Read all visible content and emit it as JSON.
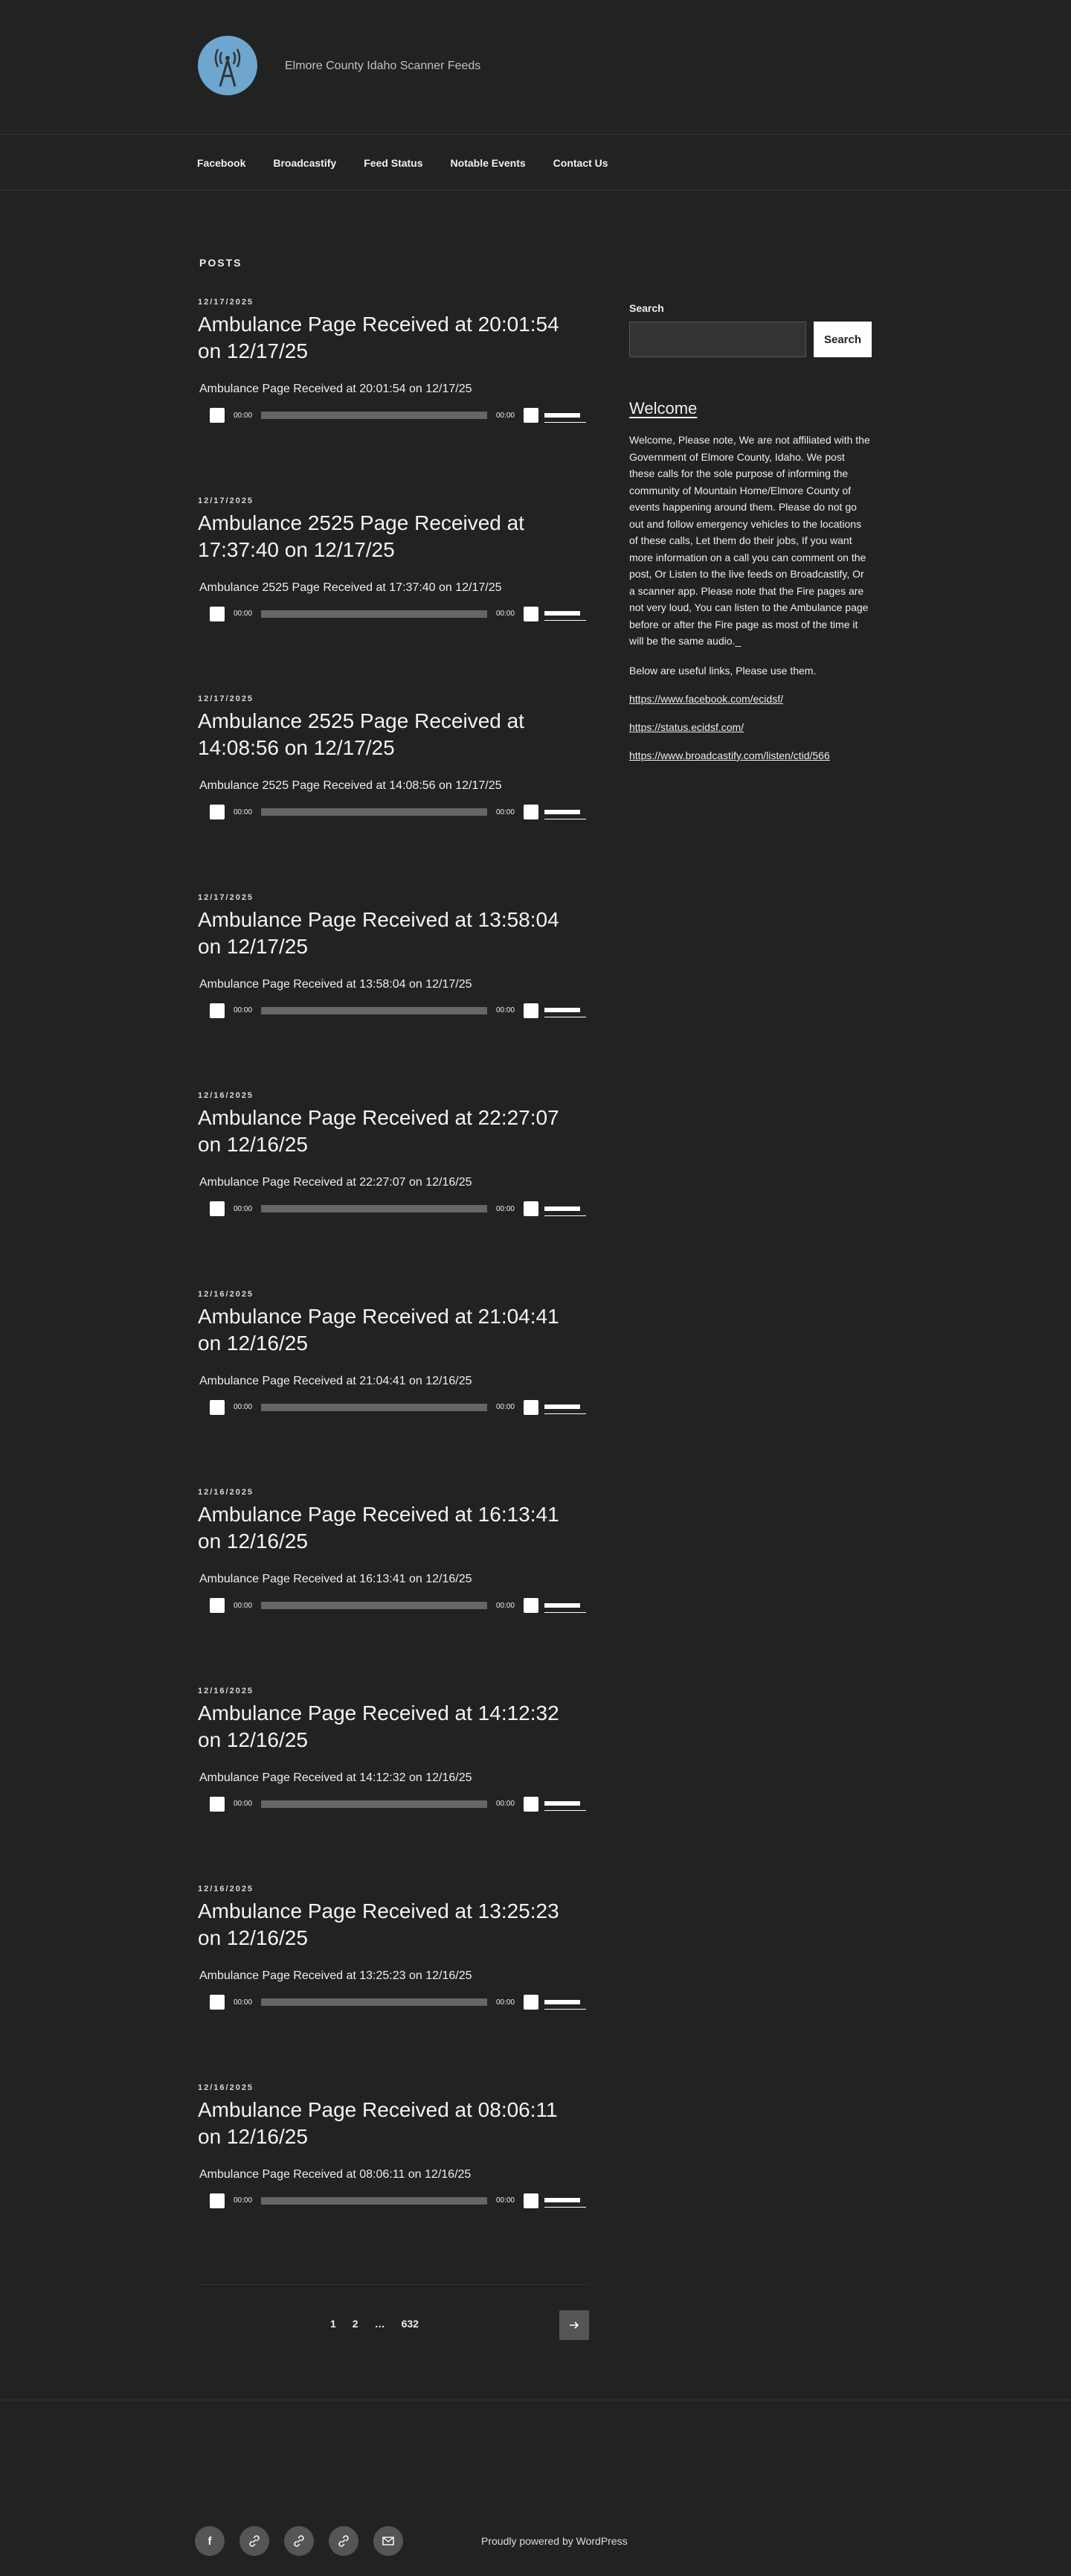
{
  "site": {
    "description": "Elmore County Idaho Scanner Feeds"
  },
  "nav": [
    "Facebook",
    "Broadcastify",
    "Feed Status",
    "Notable Events",
    "Contact Us"
  ],
  "page_title": "POSTS",
  "posts": [
    {
      "date": "12/17/2025",
      "title": "Ambulance Page Received at 20:01:54 on 12/17/25",
      "sub": "Ambulance Page Received at 20:01:54 on 12/17/25",
      "time_start": "00:00",
      "time_end": "00:00"
    },
    {
      "date": "12/17/2025",
      "title": "Ambulance 2525 Page Received at 17:37:40 on 12/17/25",
      "sub": "Ambulance 2525 Page Received at 17:37:40 on 12/17/25",
      "time_start": "00:00",
      "time_end": "00:00"
    },
    {
      "date": "12/17/2025",
      "title": "Ambulance 2525 Page Received at 14:08:56 on 12/17/25",
      "sub": "Ambulance 2525 Page Received at 14:08:56 on 12/17/25",
      "time_start": "00:00",
      "time_end": "00:00"
    },
    {
      "date": "12/17/2025",
      "title": "Ambulance Page Received at 13:58:04 on 12/17/25",
      "sub": "Ambulance Page Received at 13:58:04 on 12/17/25",
      "time_start": "00:00",
      "time_end": "00:00"
    },
    {
      "date": "12/16/2025",
      "title": "Ambulance Page Received at 22:27:07 on 12/16/25",
      "sub": "Ambulance Page Received at 22:27:07 on 12/16/25",
      "time_start": "00:00",
      "time_end": "00:00"
    },
    {
      "date": "12/16/2025",
      "title": "Ambulance Page Received at 21:04:41 on 12/16/25",
      "sub": "Ambulance Page Received at 21:04:41 on 12/16/25",
      "time_start": "00:00",
      "time_end": "00:00"
    },
    {
      "date": "12/16/2025",
      "title": "Ambulance Page Received at 16:13:41 on 12/16/25",
      "sub": "Ambulance Page Received at 16:13:41 on 12/16/25",
      "time_start": "00:00",
      "time_end": "00:00"
    },
    {
      "date": "12/16/2025",
      "title": "Ambulance Page Received at 14:12:32 on 12/16/25",
      "sub": "Ambulance Page Received at 14:12:32 on 12/16/25",
      "time_start": "00:00",
      "time_end": "00:00"
    },
    {
      "date": "12/16/2025",
      "title": "Ambulance Page Received at 13:25:23 on 12/16/25",
      "sub": "Ambulance Page Received at 13:25:23 on 12/16/25",
      "time_start": "00:00",
      "time_end": "00:00"
    },
    {
      "date": "12/16/2025",
      "title": "Ambulance Page Received at 08:06:11 on 12/16/25",
      "sub": "Ambulance Page Received at 08:06:11 on 12/16/25",
      "time_start": "00:00",
      "time_end": "00:00"
    }
  ],
  "pagination": {
    "pages": [
      "1",
      "2",
      "…",
      "632"
    ],
    "next_icon": "arrow-right-icon"
  },
  "sidebar": {
    "search_label": "Search",
    "search_button": "Search",
    "welcome_title": "Welcome",
    "welcome_text": "Welcome, Please note, We are not affiliated with the Government of Elmore County, Idaho. We post these calls for the sole purpose of informing the community of Mountain Home/Elmore County of events happening around them. Please do not go out and follow emergency vehicles to the locations of these calls, Let them do their jobs, If you want more information on a call you can comment on the post, Or Listen to the live feeds on Broadcastify, Or a scanner app. Please note that the Fire pages are not very loud, You can listen to the Ambulance page before or after the Fire page as most of the time it will be the same audio._",
    "below_text": "Below are useful links, Please use them.",
    "links": [
      "https://www.facebook.com/ecidsf/",
      "https://status.ecidsf.com/",
      "https://www.broadcastify.com/listen/ctid/566"
    ]
  },
  "footer": {
    "social_icons": [
      "facebook-icon",
      "link-icon",
      "link-icon",
      "link-icon",
      "mail-icon"
    ],
    "powered": "Proudly powered by WordPress"
  },
  "colors": {
    "background": "#222222",
    "logo": "#6ea6cf",
    "text": "#eeeeee"
  }
}
